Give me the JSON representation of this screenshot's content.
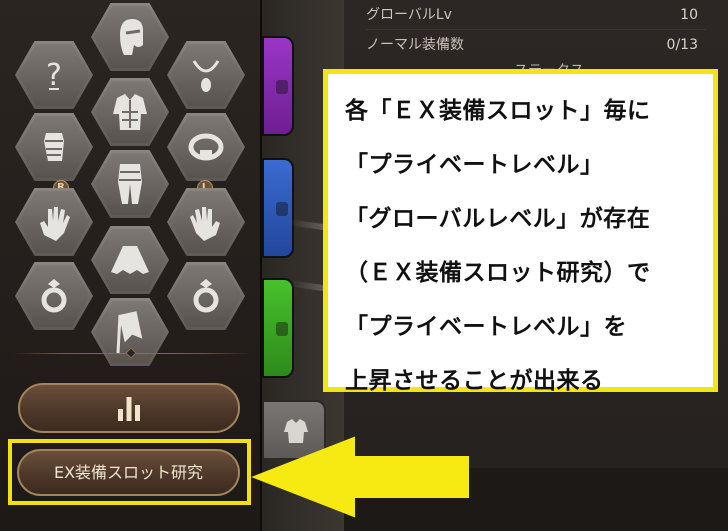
{
  "stats": {
    "global_level_label": "グローバルLv",
    "global_level_value": "10",
    "normal_equip_label": "ノーマル装備数",
    "normal_equip_value": "0/13",
    "partial_heading": "ステータス"
  },
  "equipment": {
    "left_badge": "R",
    "right_badge": "L",
    "research_button_label": "EX装備スロット研究"
  },
  "annotation": {
    "lines": [
      "各「ＥＸ装備スロット」毎に",
      "「プライベートレベル」",
      "「グローバルレベル」が存在",
      "（ＥＸ装備スロット研究）で",
      "「プライベートレベル」を",
      "上昇させることが出来る"
    ]
  },
  "colors": {
    "highlight": "#f3e10c",
    "slot_purple": "#8a2bb3",
    "slot_blue": "#2d57b8",
    "slot_green": "#3aa824"
  },
  "icons": [
    "helmet-icon",
    "unknown-slot-icon",
    "necklace-icon",
    "chest-armor-icon",
    "bracer-icon",
    "ring-band-icon",
    "pants-icon",
    "right-glove-icon",
    "left-glove-icon",
    "skirt-icon",
    "ring-icon",
    "ring-icon",
    "banner-icon",
    "bar-chart-icon"
  ]
}
